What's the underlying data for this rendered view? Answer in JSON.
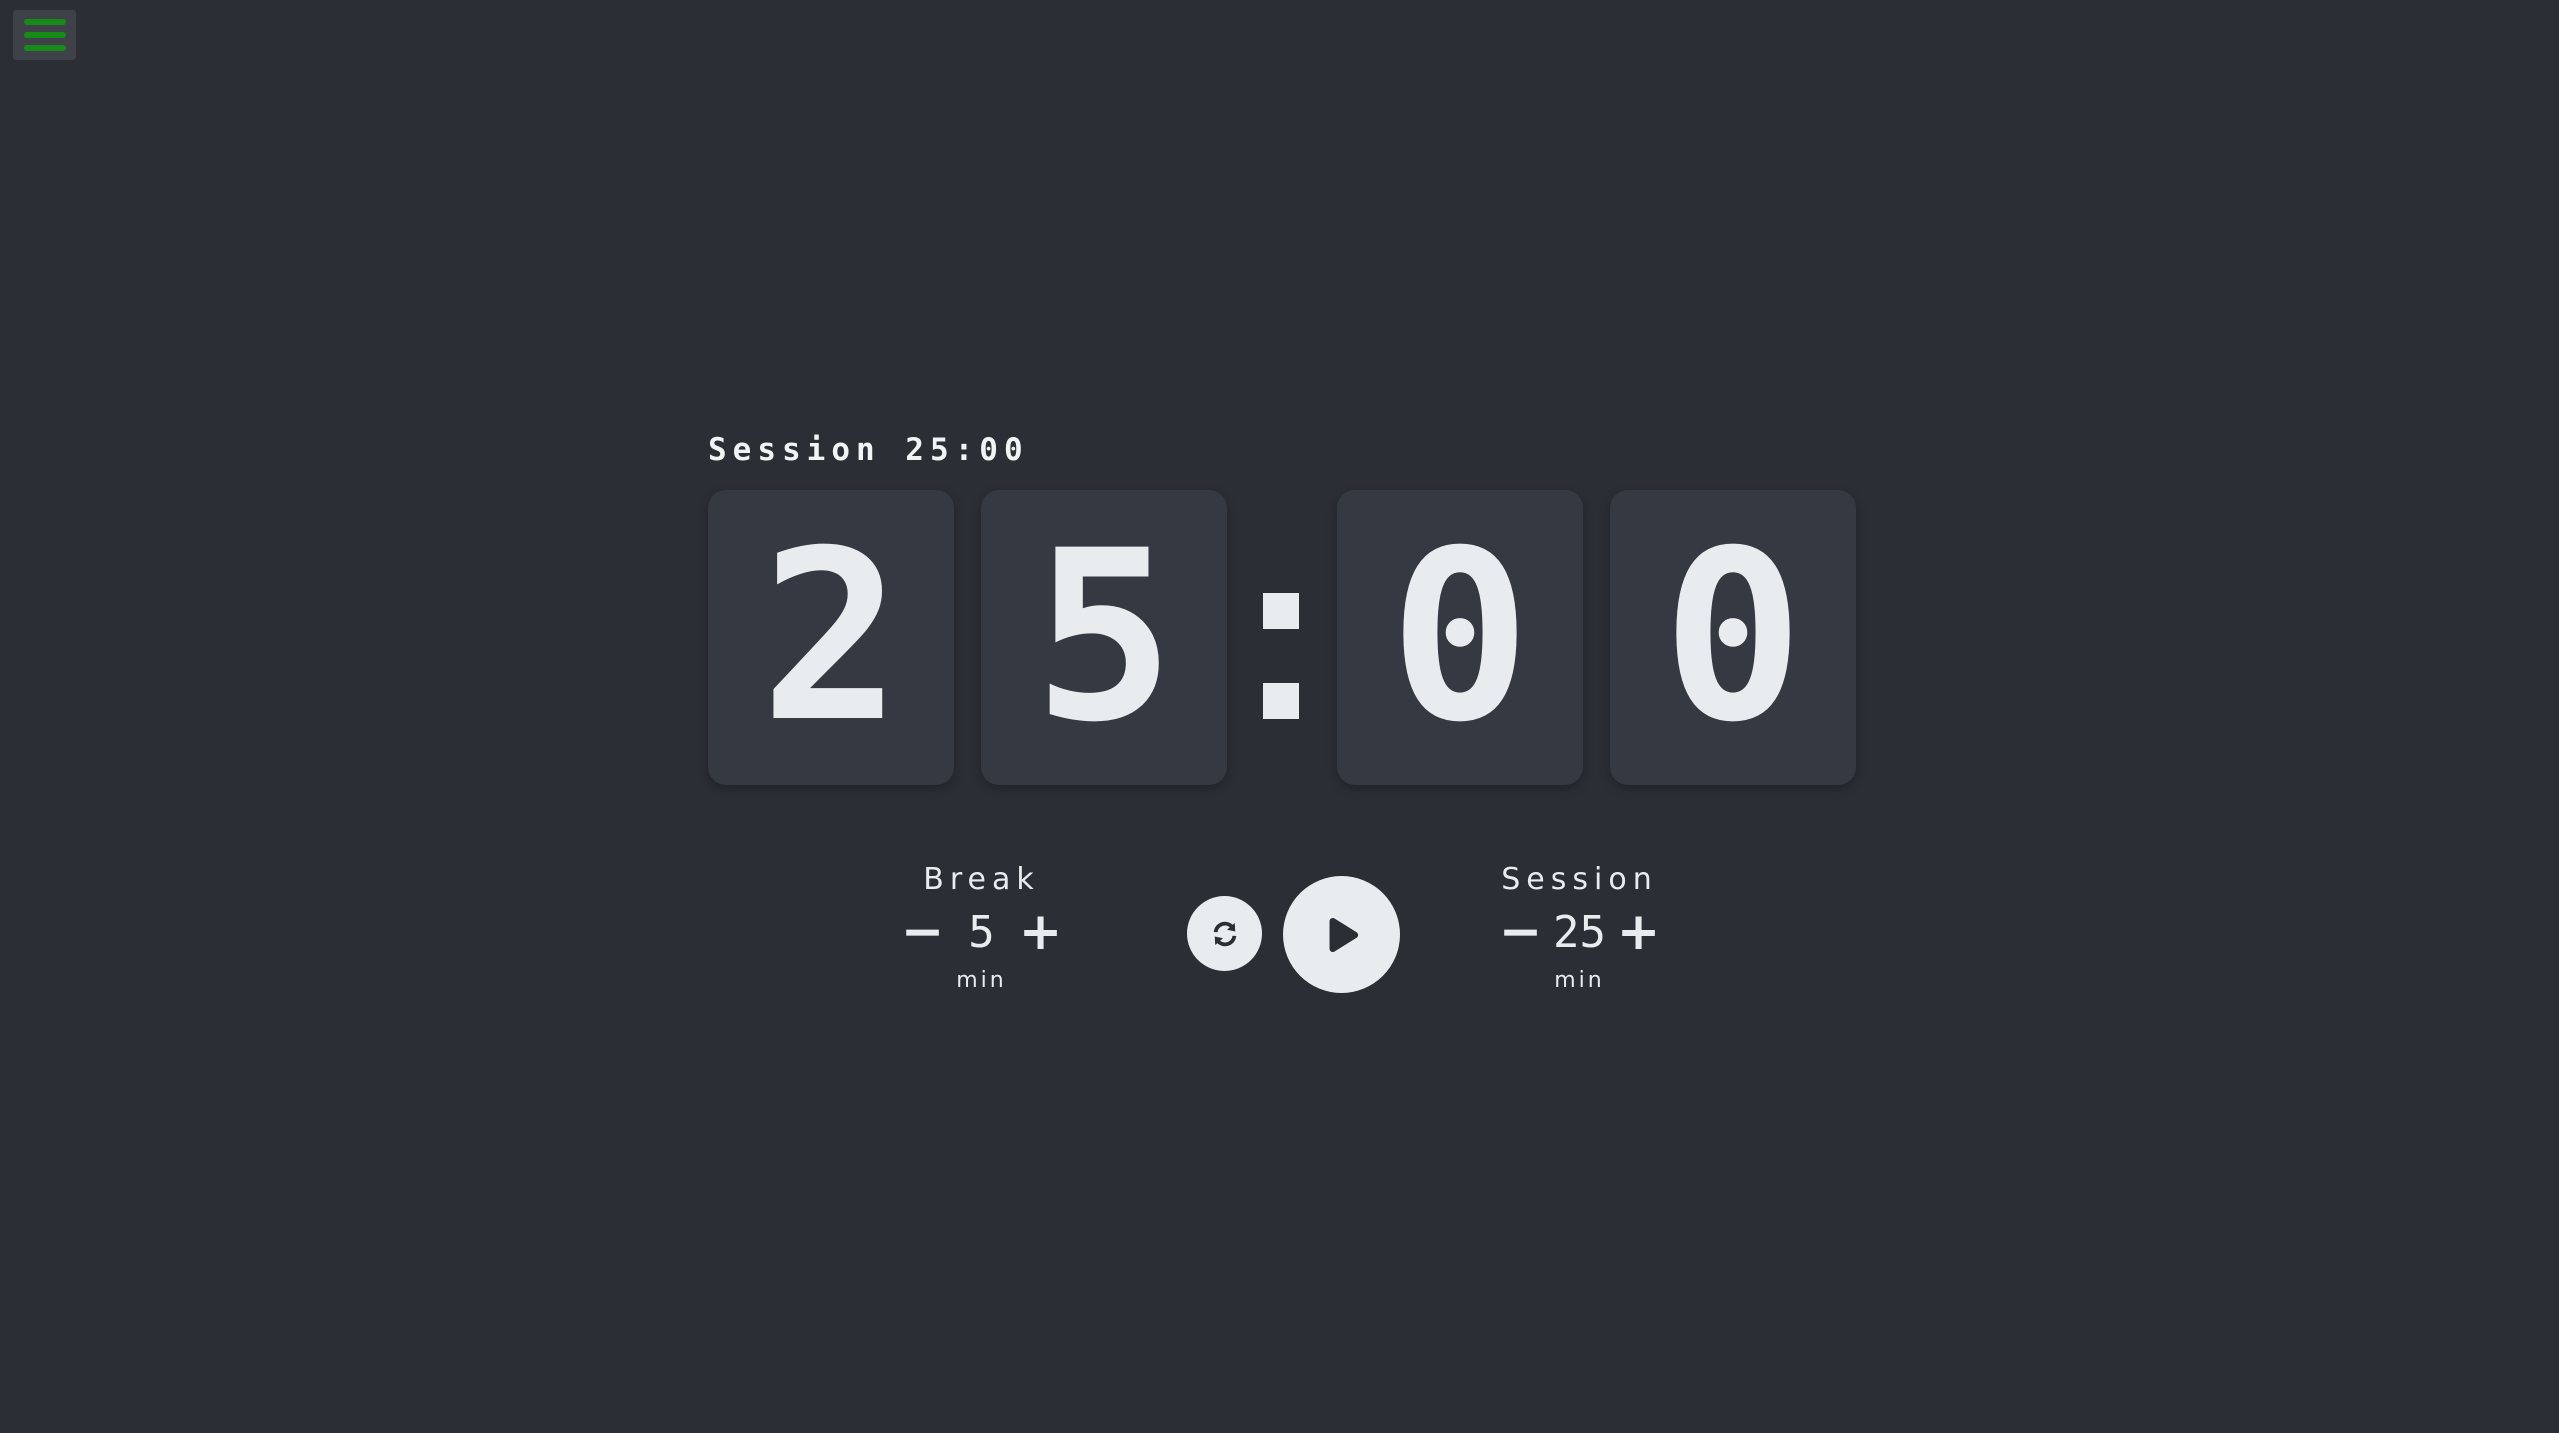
{
  "menu": {
    "icon": "hamburger-menu-icon",
    "accent": "#178a17"
  },
  "timer": {
    "label": "Session 25:00",
    "digits": [
      "2",
      "5",
      "0",
      "0"
    ],
    "separator": ":"
  },
  "break_control": {
    "label": "Break",
    "decrement": "−",
    "value": "5",
    "increment": "+",
    "unit": "min"
  },
  "session_control": {
    "label": "Session",
    "decrement": "−",
    "value": "25",
    "increment": "+",
    "unit": "min"
  },
  "buttons": {
    "reset_icon": "refresh-icon",
    "play_icon": "play-icon"
  },
  "colors": {
    "background": "#2b2e35",
    "card": "#353941",
    "foreground": "#e9ecef"
  }
}
